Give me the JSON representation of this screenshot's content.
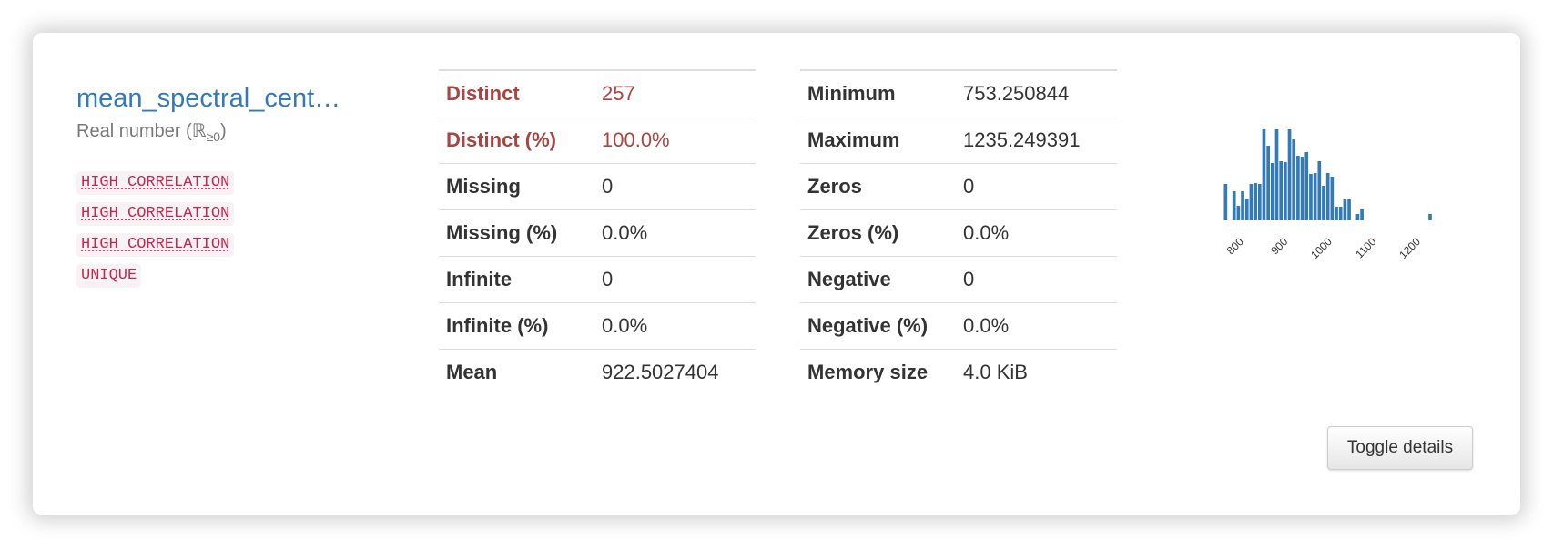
{
  "variable": {
    "name": "mean_spectral_cent…",
    "type_prefix": "Real number (ℝ",
    "type_sub": "≥0",
    "type_suffix": ")",
    "badges": [
      "HIGH CORRELATION",
      "HIGH CORRELATION",
      "HIGH CORRELATION",
      "UNIQUE"
    ]
  },
  "stats_left": [
    {
      "label": "Distinct",
      "value": "257"
    },
    {
      "label": "Distinct (%)",
      "value": "100.0%"
    },
    {
      "label": "Missing",
      "value": "0"
    },
    {
      "label": "Missing (%)",
      "value": "0.0%"
    },
    {
      "label": "Infinite",
      "value": "0"
    },
    {
      "label": "Infinite (%)",
      "value": "0.0%"
    },
    {
      "label": "Mean",
      "value": "922.5027404"
    }
  ],
  "stats_right": [
    {
      "label": "Minimum",
      "value": "753.250844"
    },
    {
      "label": "Maximum",
      "value": "1235.249391"
    },
    {
      "label": "Zeros",
      "value": "0"
    },
    {
      "label": "Zeros (%)",
      "value": "0.0%"
    },
    {
      "label": "Negative",
      "value": "0"
    },
    {
      "label": "Negative (%)",
      "value": "0.0%"
    },
    {
      "label": "Memory size",
      "value": "4.0 KiB"
    }
  ],
  "toggle_label": "Toggle details",
  "colors": {
    "bar": "#337ab7",
    "alert": "#a94442",
    "link": "#337ab7"
  },
  "chart_data": {
    "type": "bar",
    "x_ticks": [
      "800",
      "900",
      "1000",
      "1100",
      "1200"
    ],
    "xlim": [
      753.25,
      1235.25
    ],
    "ylim": [
      0,
      10
    ],
    "bin_width": 9.64,
    "bin_start": 753.25,
    "values": [
      4,
      0,
      3.2,
      1.6,
      3.2,
      2.4,
      4,
      4.1,
      4,
      10,
      8.2,
      6.3,
      10,
      6.5,
      6.4,
      10,
      8.9,
      7.1,
      7,
      7.5,
      5.1,
      5.2,
      6.5,
      3.8,
      5.2,
      4.8,
      1.5,
      1.5,
      2.3,
      2.3,
      0,
      0.7,
      1.2,
      0,
      0,
      0,
      0,
      0,
      0,
      0,
      0,
      0,
      0,
      0,
      0,
      0,
      0,
      0,
      0.7,
      0
    ]
  }
}
